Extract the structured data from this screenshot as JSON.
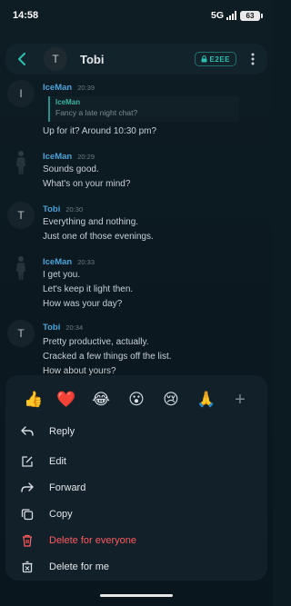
{
  "status_bar": {
    "time": "14:58",
    "network": "5G",
    "battery": "63"
  },
  "header": {
    "avatar_initial": "T",
    "title": "Tobi",
    "badge": "E2EE"
  },
  "messages": [
    {
      "sender": "IceMan",
      "time": "20:39",
      "avatar_initial": "I",
      "quote": {
        "sender": "IceMan",
        "text": "Fancy a late night chat?"
      },
      "lines": [
        "Up for it? Around 10:30 pm?"
      ]
    },
    {
      "sender": "IceMan",
      "time": "20:29",
      "avatar_initial": "",
      "lines": [
        "Sounds good.",
        "What's on your mind?"
      ]
    },
    {
      "sender": "Tobi",
      "time": "20:30",
      "avatar_initial": "T",
      "lines": [
        "Everything and nothing.",
        "Just one of those evenings."
      ]
    },
    {
      "sender": "IceMan",
      "time": "20:33",
      "avatar_initial": "",
      "lines": [
        "I get you.",
        "Let's keep it light then.",
        "How was your day?"
      ]
    },
    {
      "sender": "Tobi",
      "time": "20:34",
      "avatar_initial": "T",
      "lines": [
        "Pretty productive, actually.",
        "Cracked a few things off the list.",
        "How about yours?"
      ]
    }
  ],
  "reactions": [
    "👍",
    "❤️",
    "😂",
    "😮",
    "😢",
    "🙏",
    "+"
  ],
  "menu": {
    "reply": "Reply",
    "edit": "Edit",
    "forward": "Forward",
    "copy": "Copy",
    "delete_everyone": "Delete for everyone",
    "delete_me": "Delete for me"
  },
  "colors": {
    "accent": "#4aa3d8",
    "quote_bar": "#2a8f86",
    "danger": "#ff5a5f",
    "e2ee": "#2fbfb0"
  }
}
